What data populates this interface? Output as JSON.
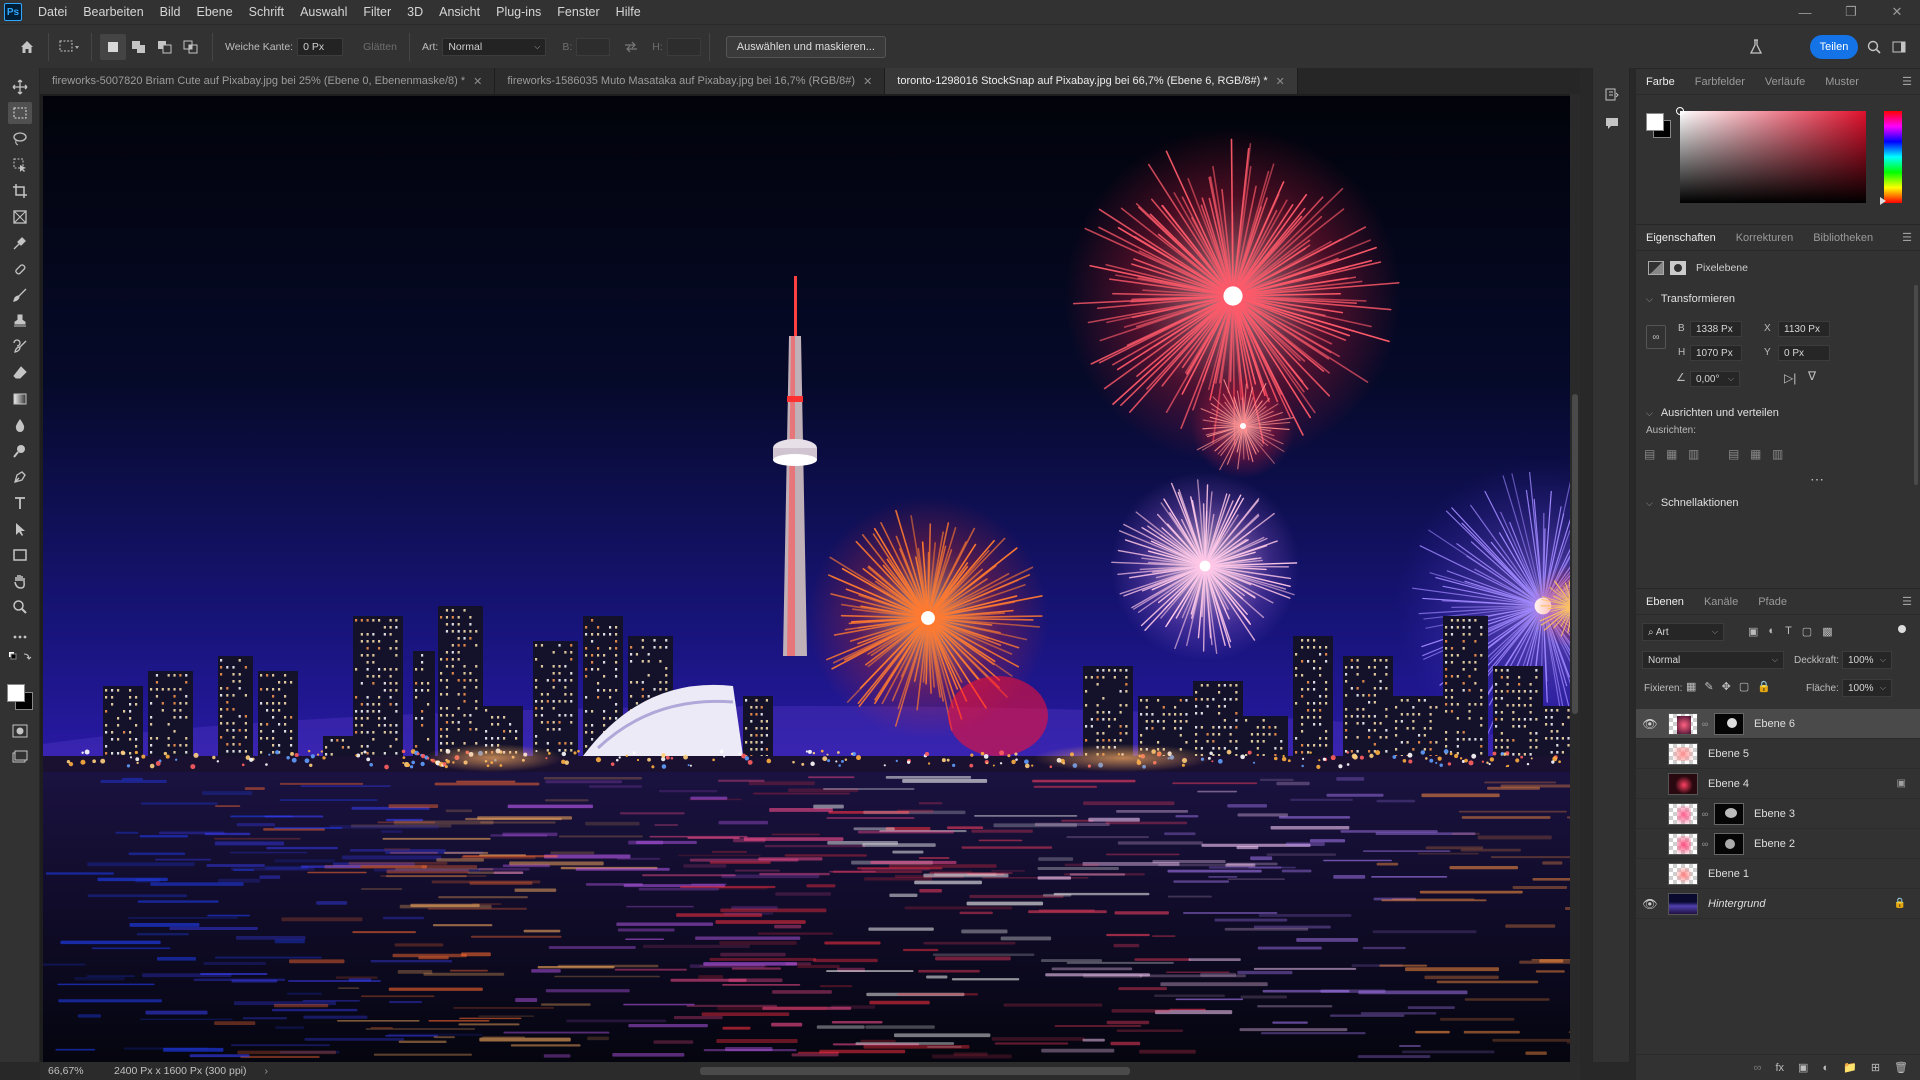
{
  "app": {
    "logo": "Ps"
  },
  "menu": [
    "Datei",
    "Bearbeiten",
    "Bild",
    "Ebene",
    "Schrift",
    "Auswahl",
    "Filter",
    "3D",
    "Ansicht",
    "Plug-ins",
    "Fenster",
    "Hilfe"
  ],
  "options": {
    "feather_label": "Weiche Kante:",
    "feather_value": "0 Px",
    "smooth_label": "Glätten",
    "style_label": "Art:",
    "style_value": "Normal",
    "width_label": "B:",
    "height_label": "H:",
    "select_mask_button": "Auswählen und maskieren...",
    "share_button": "Teilen"
  },
  "tabs": [
    {
      "title": "fireworks-5007820 Briam Cute auf Pixabay.jpg bei 25% (Ebene 0, Ebenenmaske/8) *",
      "active": false
    },
    {
      "title": "fireworks-1586035 Muto Masataka auf Pixabay.jpg bei 16,7% (RGB/8#)",
      "active": false
    },
    {
      "title": "toronto-1298016 StockSnap auf Pixabay.jpg bei 66,7% (Ebene 6, RGB/8#) *",
      "active": true
    }
  ],
  "status": {
    "zoom": "66,67%",
    "doc_info": "2400 Px x 1600 Px (300 ppi)"
  },
  "color_panel": {
    "tabs": [
      "Farbe",
      "Farbfelder",
      "Verläufe",
      "Muster"
    ],
    "active_tab": "Farbe",
    "foreground": "#ffffff",
    "background": "#000000",
    "hue_color": "#e0102c"
  },
  "properties": {
    "tabs": [
      "Eigenschaften",
      "Korrekturen",
      "Bibliotheken"
    ],
    "layer_type": "Pixelebene",
    "transform_title": "Transformieren",
    "w_label": "B",
    "w_value": "1338 Px",
    "h_label": "H",
    "h_value": "1070 Px",
    "x_label": "X",
    "x_value": "1130 Px",
    "y_label": "Y",
    "y_value": "0 Px",
    "angle_value": "0,00°",
    "align_title": "Ausrichten und verteilen",
    "align_sub": "Ausrichten:",
    "quick_actions_title": "Schnellaktionen"
  },
  "layers_panel": {
    "tabs": [
      "Ebenen",
      "Kanäle",
      "Pfade"
    ],
    "filter_kind": "Art",
    "blend_mode": "Normal",
    "opacity_label": "Deckkraft:",
    "opacity_value": "100%",
    "lock_label": "Fixieren:",
    "fill_label": "Fläche:",
    "fill_value": "100%",
    "layers": [
      {
        "name": "Ebene 6",
        "visible": true,
        "selected": true,
        "has_mask": true
      },
      {
        "name": "Ebene 5",
        "visible": false,
        "selected": false,
        "has_mask": false
      },
      {
        "name": "Ebene 4",
        "visible": false,
        "selected": false,
        "has_mask": false
      },
      {
        "name": "Ebene 3",
        "visible": false,
        "selected": false,
        "has_mask": true
      },
      {
        "name": "Ebene 2",
        "visible": false,
        "selected": false,
        "has_mask": true
      },
      {
        "name": "Ebene 1",
        "visible": false,
        "selected": false,
        "has_mask": false
      },
      {
        "name": "Hintergrund",
        "visible": true,
        "selected": false,
        "has_mask": false,
        "locked": true
      }
    ]
  }
}
